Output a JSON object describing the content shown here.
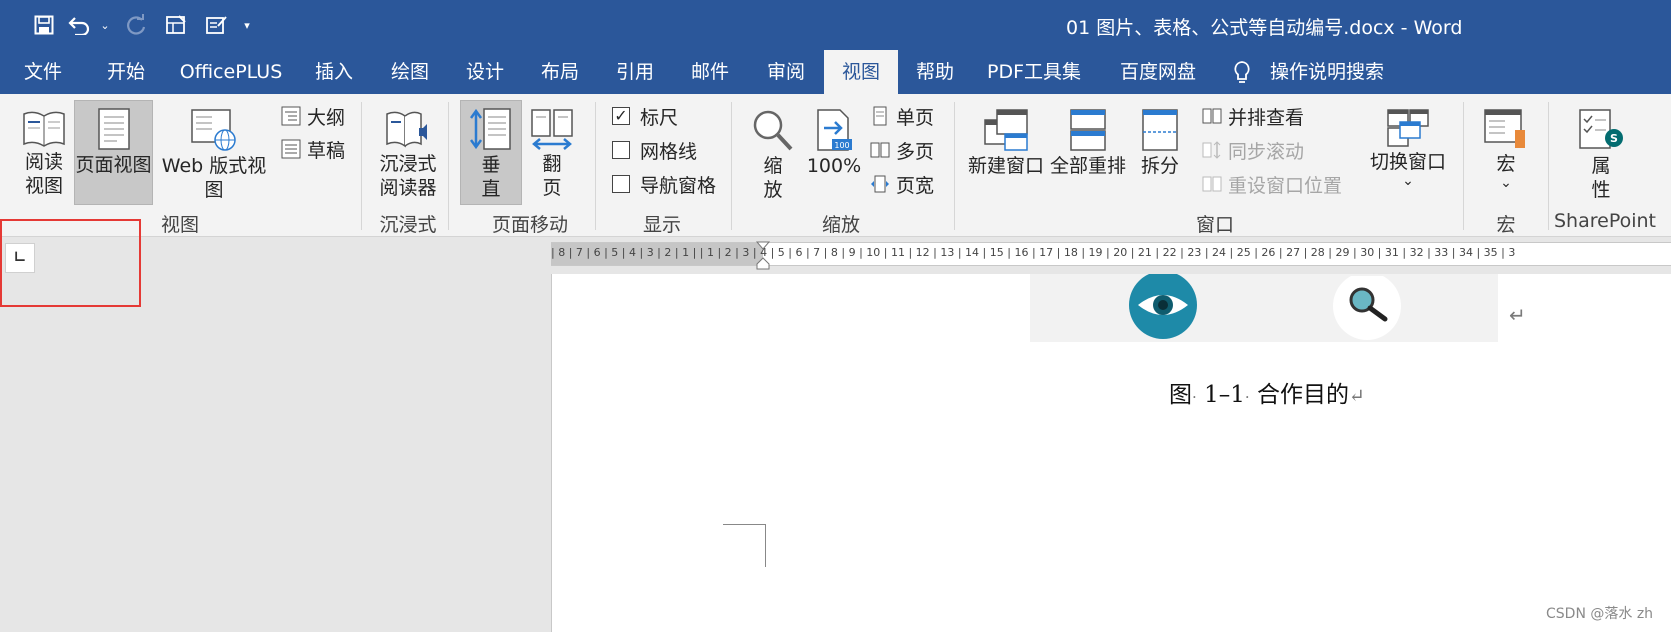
{
  "window": {
    "title": "01 图片、表格、公式等自动编号.docx  -  Word"
  },
  "qat": {
    "save_icon": "save-icon",
    "undo_icon": "undo-icon",
    "redo_icon": "redo-icon",
    "more_label": "▾",
    "undo_more": "⌄"
  },
  "tabs": [
    {
      "label": "文件"
    },
    {
      "label": "开始"
    },
    {
      "label": "OfficePLUS"
    },
    {
      "label": "插入"
    },
    {
      "label": "绘图"
    },
    {
      "label": "设计"
    },
    {
      "label": "布局"
    },
    {
      "label": "引用"
    },
    {
      "label": "邮件"
    },
    {
      "label": "审阅"
    },
    {
      "label": "视图"
    },
    {
      "label": "帮助"
    },
    {
      "label": "PDF工具集"
    },
    {
      "label": "百度网盘"
    },
    {
      "label": "操作说明搜索"
    }
  ],
  "active_tab": "视图",
  "ribbon": {
    "views": {
      "read_line1": "阅读",
      "read_line2": "视图",
      "print_layout": "页面视图",
      "web_layout": "Web 版式视图",
      "outline": "大纲",
      "draft": "草稿",
      "label": "视图"
    },
    "immersive": {
      "reader_line1": "沉浸式",
      "reader_line2": "阅读器",
      "label": "沉浸式"
    },
    "page_movement": {
      "vertical_line1": "垂",
      "vertical_line2": "直",
      "side_line1": "翻",
      "side_line2": "页",
      "label": "页面移动"
    },
    "show": {
      "ruler": "标尺",
      "ruler_checked": true,
      "gridlines": "网格线",
      "gridlines_checked": false,
      "nav_pane": "导航窗格",
      "nav_pane_checked": false,
      "label": "显示"
    },
    "zoom": {
      "zoom_line1": "缩",
      "zoom_line2": "放",
      "hundred": "100%",
      "hundred_badge": "100",
      "one_page": "单页",
      "multi_page": "多页",
      "page_width": "页宽",
      "label": "缩放"
    },
    "window": {
      "new_window": "新建窗口",
      "arrange_all": "全部重排",
      "split": "拆分",
      "side_by_side": "并排查看",
      "sync_scroll": "同步滚动",
      "reset_position": "重设窗口位置",
      "switch_windows": "切换窗口",
      "switch_arrow": "⌄",
      "label": "窗口"
    },
    "macros": {
      "macros": "宏",
      "arrow": "⌄",
      "label": "宏"
    },
    "sharepoint": {
      "props_line1": "属",
      "props_line2": "性",
      "label": "SharePoint"
    }
  },
  "ruler": {
    "tab_selector": "∟",
    "ticks": "| 8 | 7 | 6 | 5 | 4 | 3 | 2 | 1 |          | 1 | 2 | 3 | 4 | 5 | 6 | 7 | 8 | 9 | 10 | 11 | 12 | 13 | 14 | 15 | 16 | 17 | 18 | 19 | 20 | 21 | 22 | 23 | 24 | 25 | 26 | 27 | 28 | 29 | 30 | 31 | 32 | 33 | 34 | 35 | 3"
  },
  "document": {
    "caption_prefix": "图",
    "caption_number": "1–1",
    "caption_text": "合作目的",
    "caption_dot": "·",
    "return_mark": "↵"
  },
  "watermark": "CSDN @落水 zh",
  "colors": {
    "title_bar": "#2b579a",
    "ribbon": "#f3f3f3",
    "highlight": "#e53935",
    "eye": "#1e8aa8"
  }
}
